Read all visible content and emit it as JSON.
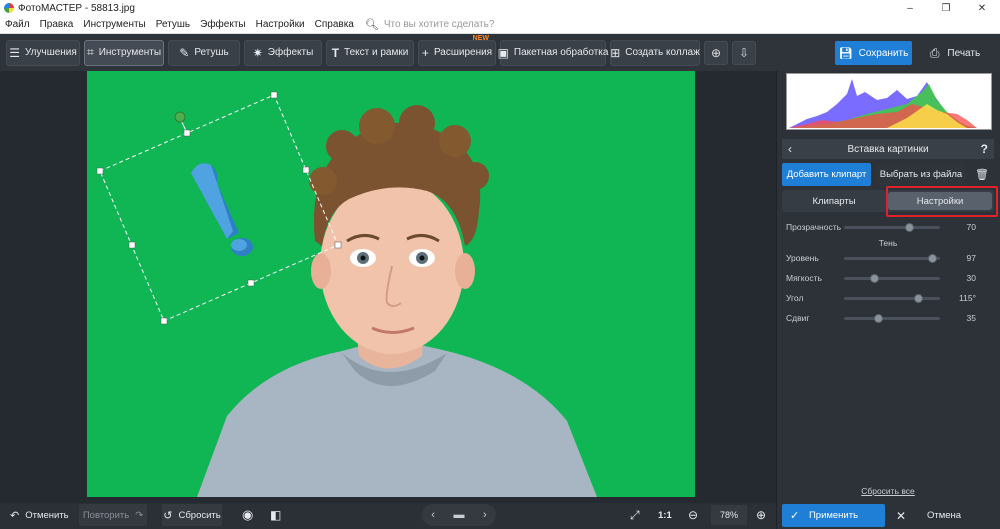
{
  "window": {
    "title": "ФотоМАСТЕР - 58813.jpg",
    "minimize": "–",
    "maximize": "❐",
    "close": "✕"
  },
  "menu": {
    "items": [
      "Файл",
      "Правка",
      "Инструменты",
      "Ретушь",
      "Эффекты",
      "Настройки",
      "Справка"
    ],
    "search_placeholder": "Что вы хотите сделать?"
  },
  "toolbar": {
    "tabs": [
      {
        "label": "Улучшения",
        "icon": "sliders-icon"
      },
      {
        "label": "Инструменты",
        "icon": "crop-icon",
        "active": true
      },
      {
        "label": "Ретушь",
        "icon": "brush-icon"
      },
      {
        "label": "Эффекты",
        "icon": "magic-wand-icon"
      },
      {
        "label": "Текст и рамки",
        "icon": "text-icon"
      },
      {
        "label": "Расширения",
        "icon": "plus-icon",
        "badge": "NEW"
      },
      {
        "label": "Пакетная обработка",
        "icon": "batch-icon"
      },
      {
        "label": "Создать коллаж",
        "icon": "collage-icon"
      }
    ],
    "save_label": "Сохранить",
    "print_label": "Печать"
  },
  "panel": {
    "title": "Вставка картинки",
    "help": "?",
    "add_clipart": "Добавить клипарт",
    "choose_file": "Выбрать из файла",
    "tab_cliparts": "Клипарты",
    "tab_settings": "Настройки",
    "opacity": {
      "label": "Прозрачность",
      "value": "70",
      "fraction": 0.7
    },
    "shadow_title": "Тень",
    "shadow": [
      {
        "label": "Уровень",
        "value": "97",
        "fraction": 0.97
      },
      {
        "label": "Мягкость",
        "value": "30",
        "fraction": 0.3
      },
      {
        "label": "Угол",
        "value": "115°",
        "fraction": 0.8
      },
      {
        "label": "Сдвиг",
        "value": "35",
        "fraction": 0.35
      }
    ],
    "reset_all": "Сбросить все",
    "apply": "Применить",
    "cancel": "Отмена"
  },
  "bottom": {
    "undo": "Отменить",
    "redo": "Повторить",
    "reset": "Сбросить",
    "one_to_one": "1:1",
    "zoom": "78%"
  },
  "colors": {
    "accent": "#1f7fd6",
    "background": "#0fb653",
    "highlight": "#e0222a"
  }
}
